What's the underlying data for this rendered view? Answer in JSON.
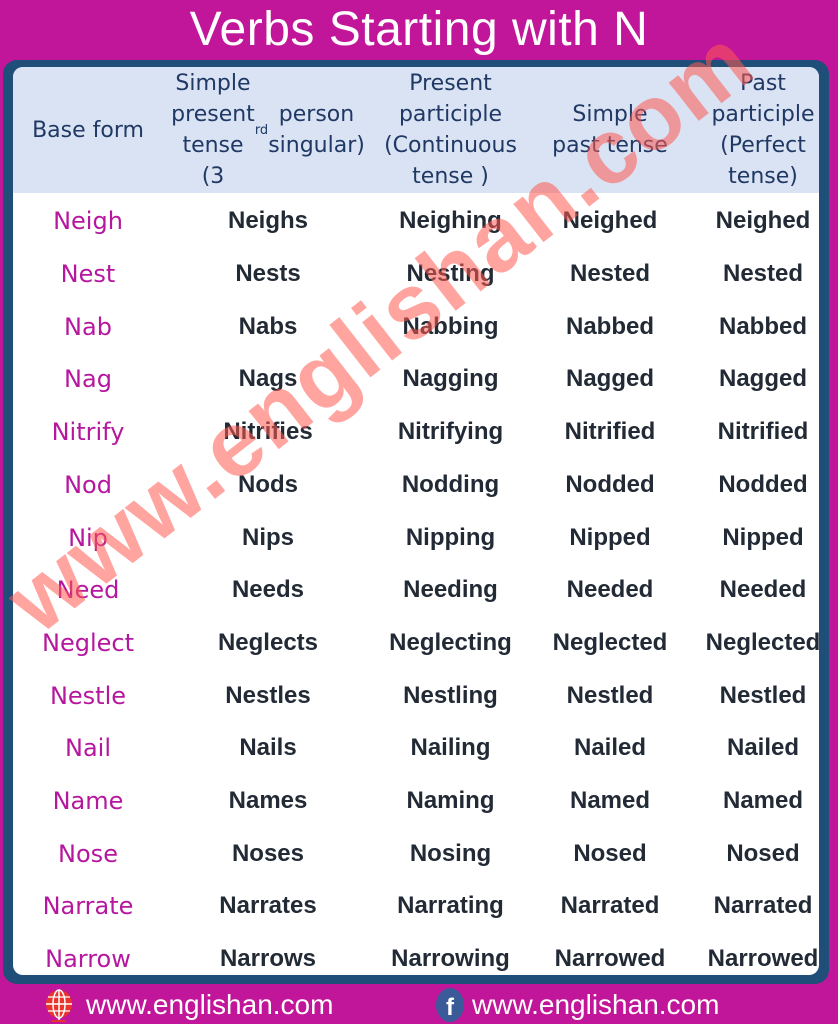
{
  "title": "Verbs Starting with N",
  "headers": [
    {
      "text": "Base form"
    },
    {
      "pre": "Simple\npresent tense\n(3",
      "sup": "rd",
      "post": " person\nsingular)"
    },
    {
      "text": "Present\nparticiple\n(Continuous\ntense )"
    },
    {
      "text": "Simple\npast tense"
    },
    {
      "text": "Past\nparticiple\n(Perfect\ntense)"
    }
  ],
  "rows": [
    [
      "Neigh",
      "Neighs",
      "Neighing",
      "Neighed",
      "Neighed"
    ],
    [
      "Nest",
      "Nests",
      "Nesting",
      "Nested",
      "Nested"
    ],
    [
      "Nab",
      "Nabs",
      "Nabbing",
      "Nabbed",
      "Nabbed"
    ],
    [
      "Nag",
      "Nags",
      "Nagging",
      "Nagged",
      "Nagged"
    ],
    [
      "Nitrify",
      "Nitrifies",
      "Nitrifying",
      "Nitrified",
      "Nitrified"
    ],
    [
      "Nod",
      "Nods",
      "Nodding",
      "Nodded",
      "Nodded"
    ],
    [
      "Nip",
      "Nips",
      "Nipping",
      "Nipped",
      "Nipped"
    ],
    [
      "Need",
      "Needs",
      "Needing",
      "Needed",
      "Needed"
    ],
    [
      "Neglect",
      "Neglects",
      "Neglecting",
      "Neglected",
      "Neglected"
    ],
    [
      "Nestle",
      "Nestles",
      "Nestling",
      "Nestled",
      "Nestled"
    ],
    [
      "Nail",
      "Nails",
      "Nailing",
      "Nailed",
      "Nailed"
    ],
    [
      "Name",
      "Names",
      "Naming",
      "Named",
      "Named"
    ],
    [
      "Nose",
      "Noses",
      "Nosing",
      "Nosed",
      "Nosed"
    ],
    [
      "Narrate",
      "Narrates",
      "Narrating",
      "Narrated",
      "Narrated"
    ],
    [
      "Narrow",
      "Narrows",
      "Narrowing",
      "Narrowed",
      "Narrowed"
    ]
  ],
  "watermark": "www.englishan.com",
  "footer": {
    "website": {
      "icon": "globe-icon",
      "text": "www.englishan.com"
    },
    "facebook": {
      "icon": "facebook-icon",
      "glyph": "f",
      "text": "www.englishan.com"
    }
  },
  "colors": {
    "background": "#c2169a",
    "frame": "#1f4e79",
    "header_bg": "#dae3f3",
    "base_form_text": "#b5179e",
    "body_text": "#222a35",
    "watermark": "#ff5a50"
  }
}
